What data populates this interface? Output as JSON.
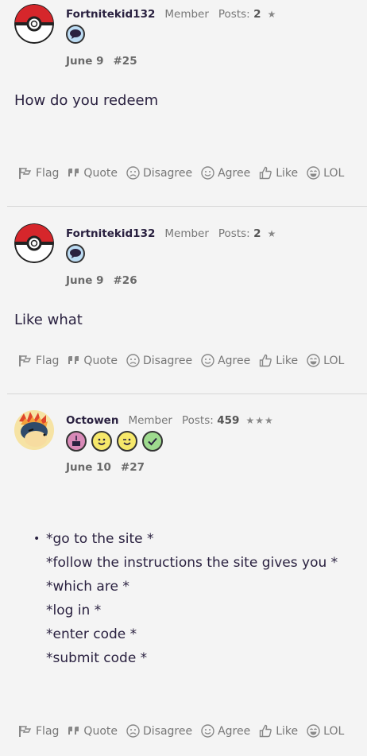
{
  "posts": [
    {
      "username": "Fortnitekid132",
      "role": "Member",
      "posts_label": "Posts:",
      "posts_count": "2",
      "stars": "★",
      "badges": [
        "speech-bubble-badge"
      ],
      "date": "June 9",
      "number": "#25",
      "body": "How do you redeem"
    },
    {
      "username": "Fortnitekid132",
      "role": "Member",
      "posts_label": "Posts:",
      "posts_count": "2",
      "stars": "★",
      "badges": [
        "speech-bubble-badge"
      ],
      "date": "June 9",
      "number": "#26",
      "body": "Like what"
    },
    {
      "username": "Octowen",
      "role": "Member",
      "posts_label": "Posts:",
      "posts_count": "459",
      "stars": "★★★",
      "badges": [
        "cake-badge",
        "smiley-badge",
        "wink-badge",
        "check-badge"
      ],
      "date": "June 10",
      "number": "#27",
      "bullet": "•",
      "steps": [
        "*go to the site *",
        "*follow the instructions the site gives you *",
        "*which are *",
        "*log in *",
        "*enter code *",
        "*submit code *"
      ]
    }
  ],
  "actions": {
    "flag": "Flag",
    "quote": "Quote",
    "disagree": "Disagree",
    "agree": "Agree",
    "like": "Like",
    "lol": "LOL"
  },
  "colors": {
    "background": "#f4f4f4",
    "text": "#2a2140",
    "muted": "#777777",
    "pokeball_red": "#d6262b",
    "badge_blue": "#bcdcf4",
    "badge_pink": "#d98ab8",
    "badge_yellow": "#f6e86a",
    "badge_green": "#9edb8e"
  }
}
